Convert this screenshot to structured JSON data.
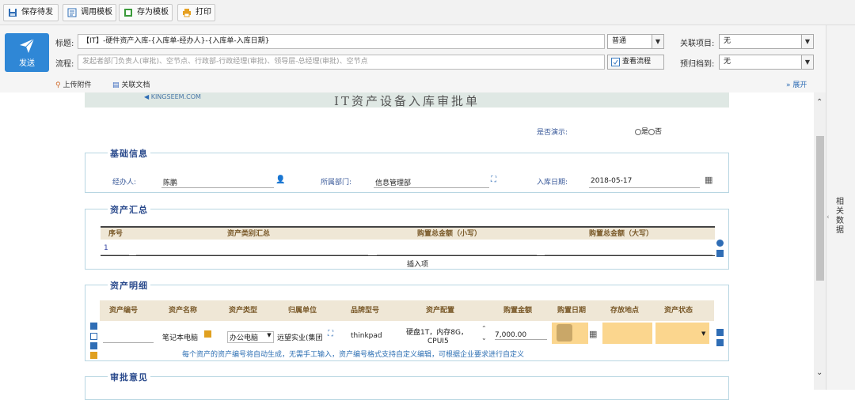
{
  "toolbar": {
    "save_draft": "保存待发",
    "use_template": "调用模板",
    "save_template": "存为模板",
    "print": "打印"
  },
  "header": {
    "send": "发送",
    "subject_label": "标题:",
    "subject": "【IT】-硬件资产入库-{入库单-经办人}-{入库单-入库日期}",
    "priority": "普通",
    "related_project_label": "关联项目:",
    "related_project": "无",
    "flow_label": "流程:",
    "flow_placeholder": "发起者部门负责人(审批)、空节点、行政部-行政经理(审批)、领导层-总经理(审批)、空节点",
    "view_flow": "查看流程",
    "archive_label": "预归档到:",
    "archive": "无",
    "attach": "上传附件",
    "related_doc": "关联文档",
    "expand": "展开"
  },
  "side_panel": {
    "label": "相关数据"
  },
  "form": {
    "logo_text": "KINGSEEM.COM",
    "title": "IT资产设备入库审批单",
    "demo_label": "是否演示:",
    "demo_yes": "是",
    "demo_no": "否",
    "basic": {
      "title": "基础信息",
      "handler_label": "经办人:",
      "handler": "陈鹏",
      "dept_label": "所属部门:",
      "dept": "信息管理部",
      "date_label": "入库日期:",
      "date": "2018-05-17"
    },
    "summary": {
      "title": "资产汇总",
      "headers": [
        "序号",
        "资产类别汇总",
        "购置总金额（小写）",
        "购置总金额（大写）"
      ],
      "row_no": "1",
      "insert": "插入项"
    },
    "detail": {
      "title": "资产明细",
      "headers": [
        "资产编号",
        "资产名称",
        "资产类型",
        "归属单位",
        "品牌型号",
        "资产配置",
        "购置金额",
        "购置日期",
        "存放地点",
        "资产状态"
      ],
      "row": {
        "name": "笔记本电脑",
        "type": "办公电脑",
        "unit": "远望实业(集团",
        "brand": "thinkpad",
        "config_1": "硬盘1T，内存8G，",
        "config_2": "CPUI5",
        "amount": "7,000.00"
      },
      "note": "每个资产的资产编号将自动生成，无需手工输入，资产编号格式支持自定义编辑，可根据企业要求进行自定义"
    },
    "approval": {
      "title": "审批意见"
    }
  },
  "colors": {
    "accent": "#2f87d6",
    "section_title": "#2a4a8c",
    "table_header": "#efe7d6",
    "highlight": "#fbd68e"
  }
}
